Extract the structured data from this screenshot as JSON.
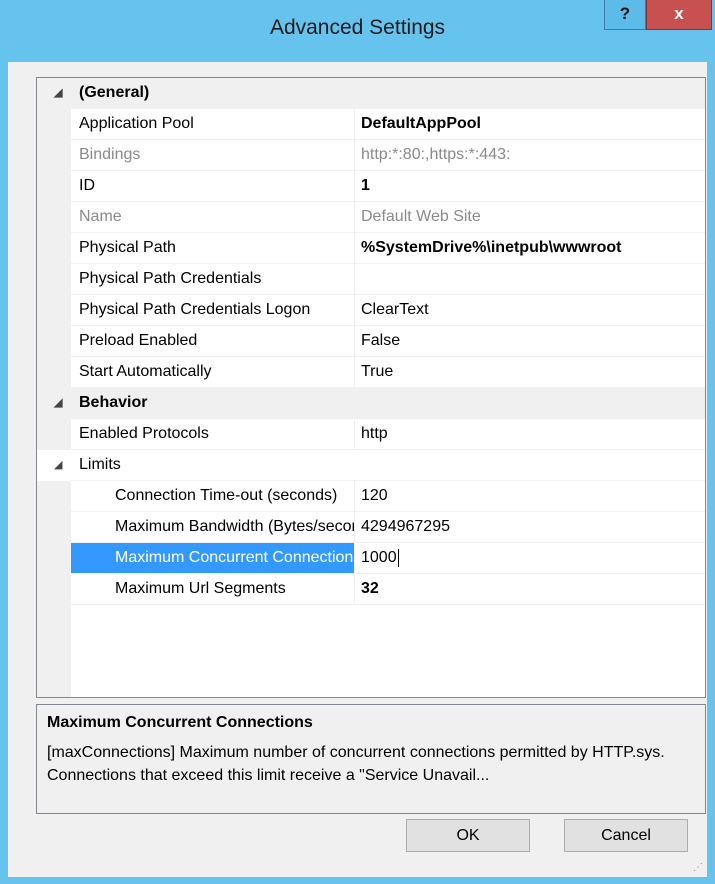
{
  "window": {
    "title": "Advanced Settings",
    "help_label": "?",
    "close_label": "x"
  },
  "grid": {
    "expander": "◢",
    "general": {
      "label": "(General)",
      "rows": [
        {
          "name": "Application Pool",
          "value": "DefaultAppPool"
        },
        {
          "name": "Bindings",
          "value": "http:*:80:,https:*:443:"
        },
        {
          "name": "ID",
          "value": "1"
        },
        {
          "name": "Name",
          "value": "Default Web Site"
        },
        {
          "name": "Physical Path",
          "value": "%SystemDrive%\\inetpub\\wwwroot"
        },
        {
          "name": "Physical Path Credentials",
          "value": ""
        },
        {
          "name": "Physical Path Credentials Logon",
          "value": "ClearText"
        },
        {
          "name": "Preload Enabled",
          "value": "False"
        },
        {
          "name": "Start Automatically",
          "value": "True"
        }
      ]
    },
    "behavior": {
      "label": "Behavior",
      "rows": [
        {
          "name": "Enabled Protocols",
          "value": "http"
        }
      ],
      "limits": {
        "label": "Limits",
        "rows": [
          {
            "name": "Connection Time-out (seconds)",
            "value": "120"
          },
          {
            "name": "Maximum Bandwidth (Bytes/second)",
            "value": "4294967295"
          },
          {
            "name": "Maximum Concurrent Connections",
            "value": "1000"
          },
          {
            "name": "Maximum Url Segments",
            "value": "32"
          }
        ]
      }
    }
  },
  "description": {
    "title": "Maximum Concurrent Connections",
    "text": "[maxConnections] Maximum number of concurrent connections permitted by HTTP.sys. Connections that exceed this limit receive a \"Service Unavail..."
  },
  "buttons": {
    "ok": "OK",
    "cancel": "Cancel"
  },
  "colors": {
    "titlebar": "#66c3ee",
    "selection": "#3399ff",
    "close": "#c75050"
  }
}
